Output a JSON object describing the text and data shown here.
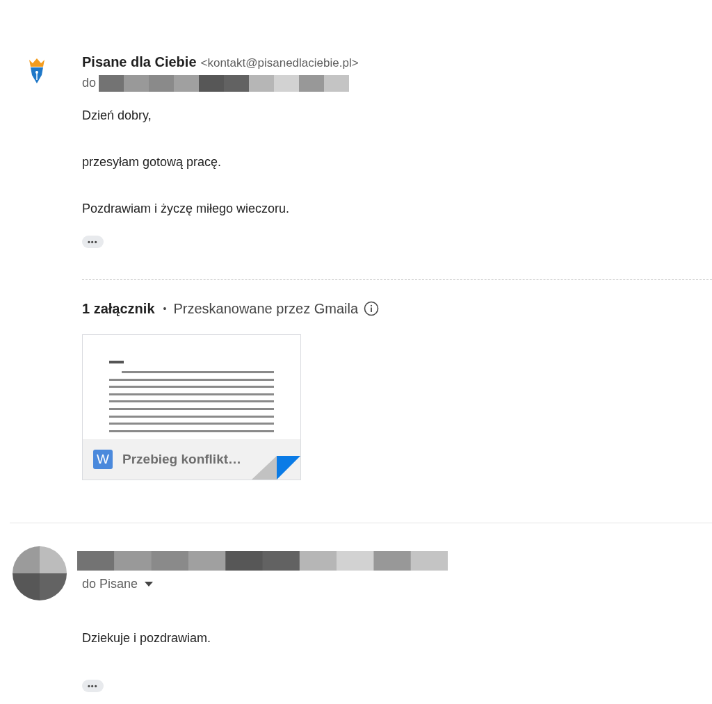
{
  "sender": {
    "name": "Pisane dla Ciebie",
    "email": "<kontakt@pisanedlaciebie.pl>",
    "to_label": "do"
  },
  "body": [
    "Dzień dobry,",
    "przesyłam gotową pracę.",
    "Pozdrawiam i życzę miłego wieczoru."
  ],
  "more_button": "•••",
  "attachments": {
    "count": "1 załącznik",
    "separator": "•",
    "scan_note": "Przeskanowane przez Gmaila",
    "files": [
      {
        "name": "Przebieg konflikt…",
        "type_badge": "W"
      }
    ]
  },
  "reply": {
    "to": "do Pisane",
    "body": "Dziekuje i pozdrawiam.",
    "more_button": "•••"
  }
}
